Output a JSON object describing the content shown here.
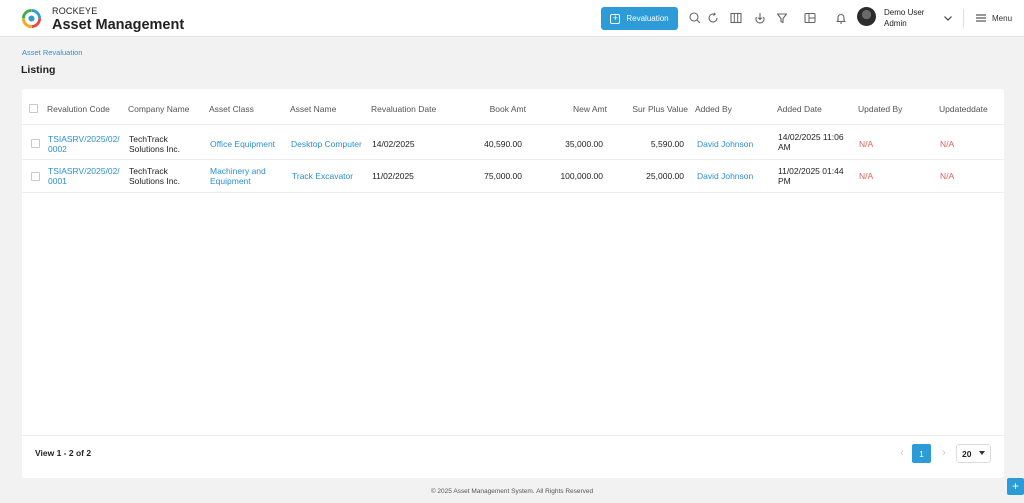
{
  "header": {
    "brand_top": "ROCKEYE",
    "brand_main": "Asset Management",
    "primary_action_label": "Revaluation",
    "user_name": "Demo User",
    "user_role": "Admin",
    "menu_label": "Menu",
    "icons": [
      "search-icon",
      "refresh-icon",
      "columns-icon",
      "download-icon",
      "filter-icon",
      "layout-icon",
      "bell-icon"
    ]
  },
  "breadcrumb": "Asset Revaluation",
  "page_title": "Listing",
  "table": {
    "columns": [
      "Revalution Code",
      "Company Name",
      "Asset Class",
      "Asset Name",
      "Revaluation Date",
      "Book Amt",
      "New Amt",
      "Sur Plus Value",
      "Added By",
      "Added Date",
      "Updated By",
      "Updateddate"
    ],
    "rows": [
      {
        "code_l1": "TSIASRV/2025/02/",
        "code_l2": "0002",
        "company_l1": "TechTrack",
        "company_l2": "Solutions Inc.",
        "class_l1": "Office Equipment",
        "class_l2": "",
        "asset_name": "Desktop Computer",
        "reval_date": "14/02/2025",
        "book_amt": "40,590.00",
        "new_amt": "35,000.00",
        "surplus": "5,590.00",
        "added_by": "David Johnson",
        "added_date_l1": "14/02/2025 11:06",
        "added_date_l2": "AM",
        "updated_by": "N/A",
        "updated_date": "N/A"
      },
      {
        "code_l1": "TSIASRV/2025/02/",
        "code_l2": "0001",
        "company_l1": "TechTrack",
        "company_l2": "Solutions Inc.",
        "class_l1": "Machinery and",
        "class_l2": "Equipment",
        "asset_name": "Track Excavator",
        "reval_date": "11/02/2025",
        "book_amt": "75,000.00",
        "new_amt": "100,000.00",
        "surplus": "25,000.00",
        "added_by": "David Johnson",
        "added_date_l1": "11/02/2025 01:44",
        "added_date_l2": "PM",
        "updated_by": "N/A",
        "updated_date": "N/A"
      }
    ]
  },
  "pagination": {
    "view_text": "View 1 - 2 of 2",
    "current_page": "1",
    "page_size": "20"
  },
  "footer_text": "© 2025 Asset Management System. All Rights Reserved",
  "colors": {
    "accent": "#2d9bd8",
    "link": "#2d8fd0",
    "na": "#e0605a"
  }
}
